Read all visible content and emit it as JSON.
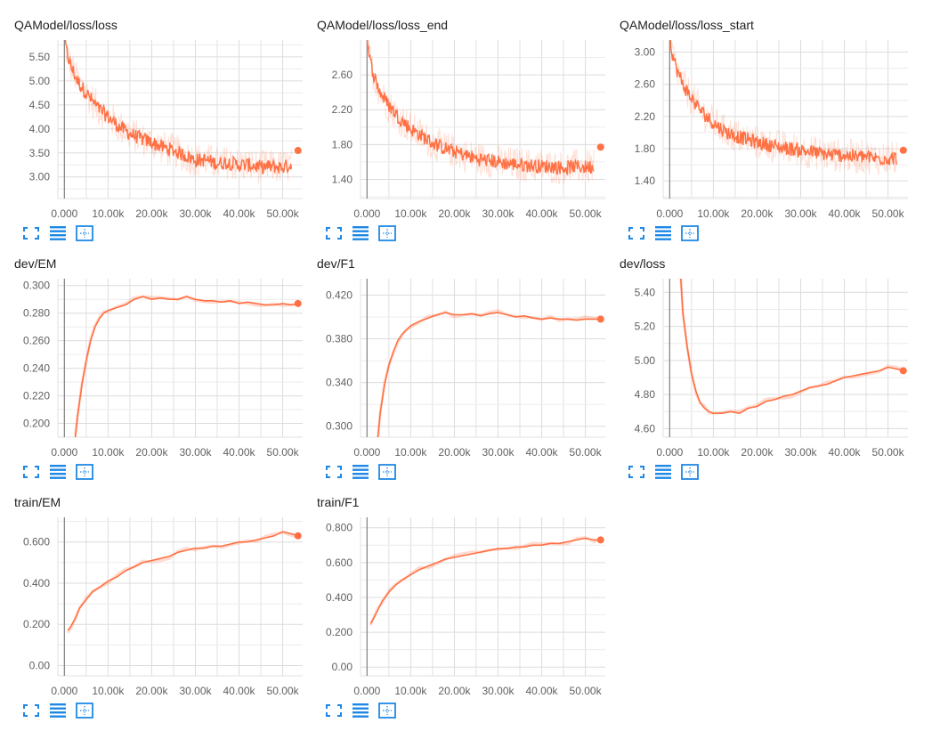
{
  "accent_color": "#ff7043",
  "toolbar_icons": [
    "fullscreen-icon",
    "list-icon",
    "fit-domain-icon"
  ],
  "chart_data": [
    {
      "id": "qamodel-loss-loss",
      "type": "line",
      "title": "QAModel/loss/loss",
      "xlim": [
        -1500,
        56000
      ],
      "ylim": [
        2.55,
        5.85
      ],
      "x_ticks": [
        0,
        10000,
        20000,
        30000,
        40000,
        50000
      ],
      "x_tick_labels": [
        "0.000",
        "10.00k",
        "20.00k",
        "30.00k",
        "40.00k",
        "50.00k"
      ],
      "y_ticks": [
        3.0,
        3.5,
        4.0,
        4.5,
        5.0,
        5.5
      ],
      "y_tick_labels": [
        "3.00",
        "3.50",
        "4.00",
        "4.50",
        "5.00",
        "5.50"
      ],
      "grid": true,
      "noisy": true,
      "curve": {
        "x": [
          0,
          500,
          1500,
          3000,
          5000,
          7500,
          10000,
          12500,
          15000,
          17500,
          20000,
          22500,
          25000,
          27500,
          30000,
          32500,
          35000,
          37500,
          40000,
          42500,
          45000,
          47500,
          50000,
          52000
        ],
        "y": [
          5.9,
          5.6,
          5.3,
          5.0,
          4.75,
          4.45,
          4.25,
          4.05,
          3.9,
          3.8,
          3.72,
          3.62,
          3.55,
          3.45,
          3.35,
          3.35,
          3.28,
          3.3,
          3.25,
          3.25,
          3.2,
          3.22,
          3.2,
          3.25
        ]
      },
      "last_point": {
        "x": 53500,
        "y": 3.55
      }
    },
    {
      "id": "qamodel-loss-loss-end",
      "type": "line",
      "title": "QAModel/loss/loss_end",
      "xlim": [
        -1500,
        56000
      ],
      "ylim": [
        1.18,
        3.0
      ],
      "x_ticks": [
        0,
        10000,
        20000,
        30000,
        40000,
        50000
      ],
      "x_tick_labels": [
        "0.000",
        "10.00k",
        "20.00k",
        "30.00k",
        "40.00k",
        "50.00k"
      ],
      "y_ticks": [
        1.4,
        1.8,
        2.2,
        2.6
      ],
      "y_tick_labels": [
        "1.40",
        "1.80",
        "2.20",
        "2.60"
      ],
      "grid": true,
      "noisy": true,
      "curve": {
        "x": [
          0,
          500,
          1500,
          3000,
          5000,
          7500,
          10000,
          12500,
          15000,
          17500,
          20000,
          22500,
          25000,
          27500,
          30000,
          32500,
          35000,
          37500,
          40000,
          42500,
          45000,
          47500,
          50000,
          52000
        ],
        "y": [
          3.05,
          2.8,
          2.6,
          2.4,
          2.25,
          2.1,
          1.98,
          1.9,
          1.82,
          1.76,
          1.72,
          1.68,
          1.64,
          1.62,
          1.6,
          1.58,
          1.57,
          1.56,
          1.55,
          1.55,
          1.53,
          1.55,
          1.54,
          1.55
        ]
      },
      "last_point": {
        "x": 53500,
        "y": 1.77
      }
    },
    {
      "id": "qamodel-loss-loss-start",
      "type": "line",
      "title": "QAModel/loss/loss_start",
      "xlim": [
        -1500,
        56000
      ],
      "ylim": [
        1.18,
        3.15
      ],
      "x_ticks": [
        0,
        10000,
        20000,
        30000,
        40000,
        50000
      ],
      "x_tick_labels": [
        "0.000",
        "10.00k",
        "20.00k",
        "30.00k",
        "40.00k",
        "50.00k"
      ],
      "y_ticks": [
        1.4,
        1.8,
        2.2,
        2.6,
        3.0
      ],
      "y_tick_labels": [
        "1.40",
        "1.80",
        "2.20",
        "2.60",
        "3.00"
      ],
      "grid": true,
      "noisy": true,
      "curve": {
        "x": [
          0,
          500,
          1500,
          3000,
          5000,
          7500,
          10000,
          12500,
          15000,
          17500,
          20000,
          22500,
          25000,
          27500,
          30000,
          32500,
          35000,
          37500,
          40000,
          42500,
          45000,
          47500,
          50000,
          52000
        ],
        "y": [
          3.3,
          3.0,
          2.8,
          2.6,
          2.42,
          2.25,
          2.12,
          2.02,
          1.96,
          1.92,
          1.88,
          1.85,
          1.82,
          1.8,
          1.78,
          1.76,
          1.74,
          1.72,
          1.72,
          1.7,
          1.7,
          1.68,
          1.68,
          1.68
        ]
      },
      "last_point": {
        "x": 53500,
        "y": 1.78
      }
    },
    {
      "id": "dev-em",
      "type": "line",
      "title": "dev/EM",
      "xlim": [
        -1500,
        56000
      ],
      "ylim": [
        0.19,
        0.305
      ],
      "x_ticks": [
        0,
        10000,
        20000,
        30000,
        40000,
        50000
      ],
      "x_tick_labels": [
        "0.000",
        "10.00k",
        "20.00k",
        "30.00k",
        "40.00k",
        "50.00k"
      ],
      "y_ticks": [
        0.2,
        0.22,
        0.24,
        0.26,
        0.28,
        0.3
      ],
      "y_tick_labels": [
        "0.200",
        "0.220",
        "0.240",
        "0.260",
        "0.280",
        "0.300"
      ],
      "grid": true,
      "noisy": false,
      "curve": {
        "x": [
          2500,
          3000,
          4000,
          5000,
          6000,
          7000,
          8000,
          9000,
          10000,
          12000,
          14000,
          16000,
          18000,
          20000,
          22000,
          24000,
          26000,
          28000,
          30000,
          32000,
          34000,
          36000,
          38000,
          40000,
          42000,
          44000,
          46000,
          48000,
          50000,
          52000,
          53500
        ],
        "y": [
          0.19,
          0.205,
          0.228,
          0.246,
          0.26,
          0.27,
          0.276,
          0.28,
          0.282,
          0.284,
          0.286,
          0.29,
          0.292,
          0.29,
          0.291,
          0.29,
          0.29,
          0.292,
          0.29,
          0.289,
          0.289,
          0.288,
          0.289,
          0.287,
          0.288,
          0.287,
          0.286,
          0.286,
          0.287,
          0.286,
          0.287
        ]
      },
      "last_point": {
        "x": 53500,
        "y": 0.287
      }
    },
    {
      "id": "dev-f1",
      "type": "line",
      "title": "dev/F1",
      "xlim": [
        -1500,
        56000
      ],
      "ylim": [
        0.29,
        0.435
      ],
      "x_ticks": [
        0,
        10000,
        20000,
        30000,
        40000,
        50000
      ],
      "x_tick_labels": [
        "0.000",
        "10.00k",
        "20.00k",
        "30.00k",
        "40.00k",
        "50.00k"
      ],
      "y_ticks": [
        0.3,
        0.34,
        0.38,
        0.42
      ],
      "y_tick_labels": [
        "0.300",
        "0.340",
        "0.380",
        "0.420"
      ],
      "grid": true,
      "noisy": false,
      "curve": {
        "x": [
          2500,
          3000,
          4000,
          5000,
          6000,
          7000,
          8000,
          9000,
          10000,
          12000,
          14000,
          16000,
          18000,
          20000,
          22000,
          24000,
          26000,
          28000,
          30000,
          32000,
          34000,
          36000,
          38000,
          40000,
          42000,
          44000,
          46000,
          48000,
          50000,
          52000,
          53500
        ],
        "y": [
          0.29,
          0.312,
          0.338,
          0.356,
          0.368,
          0.378,
          0.384,
          0.388,
          0.392,
          0.396,
          0.399,
          0.402,
          0.404,
          0.402,
          0.402,
          0.403,
          0.401,
          0.403,
          0.404,
          0.402,
          0.4,
          0.401,
          0.399,
          0.398,
          0.399,
          0.398,
          0.398,
          0.397,
          0.398,
          0.398,
          0.398
        ]
      },
      "last_point": {
        "x": 53500,
        "y": 0.398
      }
    },
    {
      "id": "dev-loss",
      "type": "line",
      "title": "dev/loss",
      "xlim": [
        -1500,
        56000
      ],
      "ylim": [
        4.55,
        5.48
      ],
      "x_ticks": [
        0,
        10000,
        20000,
        30000,
        40000,
        50000
      ],
      "x_tick_labels": [
        "0.000",
        "10.00k",
        "20.00k",
        "30.00k",
        "40.00k",
        "50.00k"
      ],
      "y_ticks": [
        4.6,
        4.8,
        5.0,
        5.2,
        5.4
      ],
      "y_tick_labels": [
        "4.60",
        "4.80",
        "5.00",
        "5.20",
        "5.40"
      ],
      "grid": true,
      "noisy": false,
      "curve": {
        "x": [
          2500,
          3000,
          4000,
          5000,
          6000,
          7000,
          8000,
          9000,
          10000,
          12000,
          14000,
          16000,
          18000,
          20000,
          22000,
          24000,
          26000,
          28000,
          30000,
          32000,
          34000,
          36000,
          38000,
          40000,
          42000,
          44000,
          46000,
          48000,
          50000,
          52000,
          53500
        ],
        "y": [
          5.5,
          5.28,
          5.08,
          4.92,
          4.82,
          4.75,
          4.72,
          4.7,
          4.69,
          4.69,
          4.7,
          4.69,
          4.72,
          4.73,
          4.76,
          4.77,
          4.79,
          4.8,
          4.82,
          4.84,
          4.85,
          4.86,
          4.88,
          4.9,
          4.91,
          4.92,
          4.93,
          4.94,
          4.96,
          4.95,
          4.94
        ]
      },
      "last_point": {
        "x": 53500,
        "y": 4.94
      }
    },
    {
      "id": "train-em",
      "type": "line",
      "title": "train/EM",
      "xlim": [
        -1500,
        56000
      ],
      "ylim": [
        -0.05,
        0.72
      ],
      "x_ticks": [
        0,
        10000,
        20000,
        30000,
        40000,
        50000
      ],
      "x_tick_labels": [
        "0.000",
        "10.00k",
        "20.00k",
        "30.00k",
        "40.00k",
        "50.00k"
      ],
      "y_ticks": [
        0.0,
        0.2,
        0.4,
        0.6
      ],
      "y_tick_labels": [
        "0.00",
        "0.200",
        "0.400",
        "0.600"
      ],
      "grid": true,
      "noisy": false,
      "curve": {
        "x": [
          800,
          1500,
          2500,
          3500,
          5000,
          6500,
          8000,
          10000,
          12000,
          14000,
          16000,
          18000,
          20000,
          22000,
          24000,
          26000,
          28000,
          30000,
          32000,
          34000,
          36000,
          38000,
          40000,
          42000,
          44000,
          46000,
          48000,
          50000,
          52000,
          53500
        ],
        "y": [
          0.17,
          0.19,
          0.23,
          0.28,
          0.32,
          0.36,
          0.38,
          0.41,
          0.43,
          0.46,
          0.48,
          0.5,
          0.51,
          0.52,
          0.53,
          0.55,
          0.56,
          0.57,
          0.57,
          0.58,
          0.58,
          0.59,
          0.6,
          0.6,
          0.61,
          0.62,
          0.63,
          0.65,
          0.64,
          0.63
        ]
      },
      "last_point": {
        "x": 53500,
        "y": 0.63
      }
    },
    {
      "id": "train-f1",
      "type": "line",
      "title": "train/F1",
      "xlim": [
        -1500,
        56000
      ],
      "ylim": [
        -0.05,
        0.86
      ],
      "x_ticks": [
        0,
        10000,
        20000,
        30000,
        40000,
        50000
      ],
      "x_tick_labels": [
        "0.000",
        "10.00k",
        "20.00k",
        "30.00k",
        "40.00k",
        "50.00k"
      ],
      "y_ticks": [
        0.0,
        0.2,
        0.4,
        0.6,
        0.8
      ],
      "y_tick_labels": [
        "0.00",
        "0.200",
        "0.400",
        "0.600",
        "0.800"
      ],
      "grid": true,
      "noisy": false,
      "curve": {
        "x": [
          800,
          1500,
          2500,
          3500,
          5000,
          6500,
          8000,
          10000,
          12000,
          14000,
          16000,
          18000,
          20000,
          22000,
          24000,
          26000,
          28000,
          30000,
          32000,
          34000,
          36000,
          38000,
          40000,
          42000,
          44000,
          46000,
          48000,
          50000,
          52000,
          53500
        ],
        "y": [
          0.25,
          0.28,
          0.33,
          0.38,
          0.43,
          0.47,
          0.5,
          0.53,
          0.56,
          0.58,
          0.6,
          0.62,
          0.63,
          0.64,
          0.65,
          0.66,
          0.67,
          0.68,
          0.68,
          0.69,
          0.69,
          0.7,
          0.7,
          0.71,
          0.71,
          0.72,
          0.73,
          0.74,
          0.73,
          0.73
        ]
      },
      "last_point": {
        "x": 53500,
        "y": 0.73
      }
    }
  ]
}
